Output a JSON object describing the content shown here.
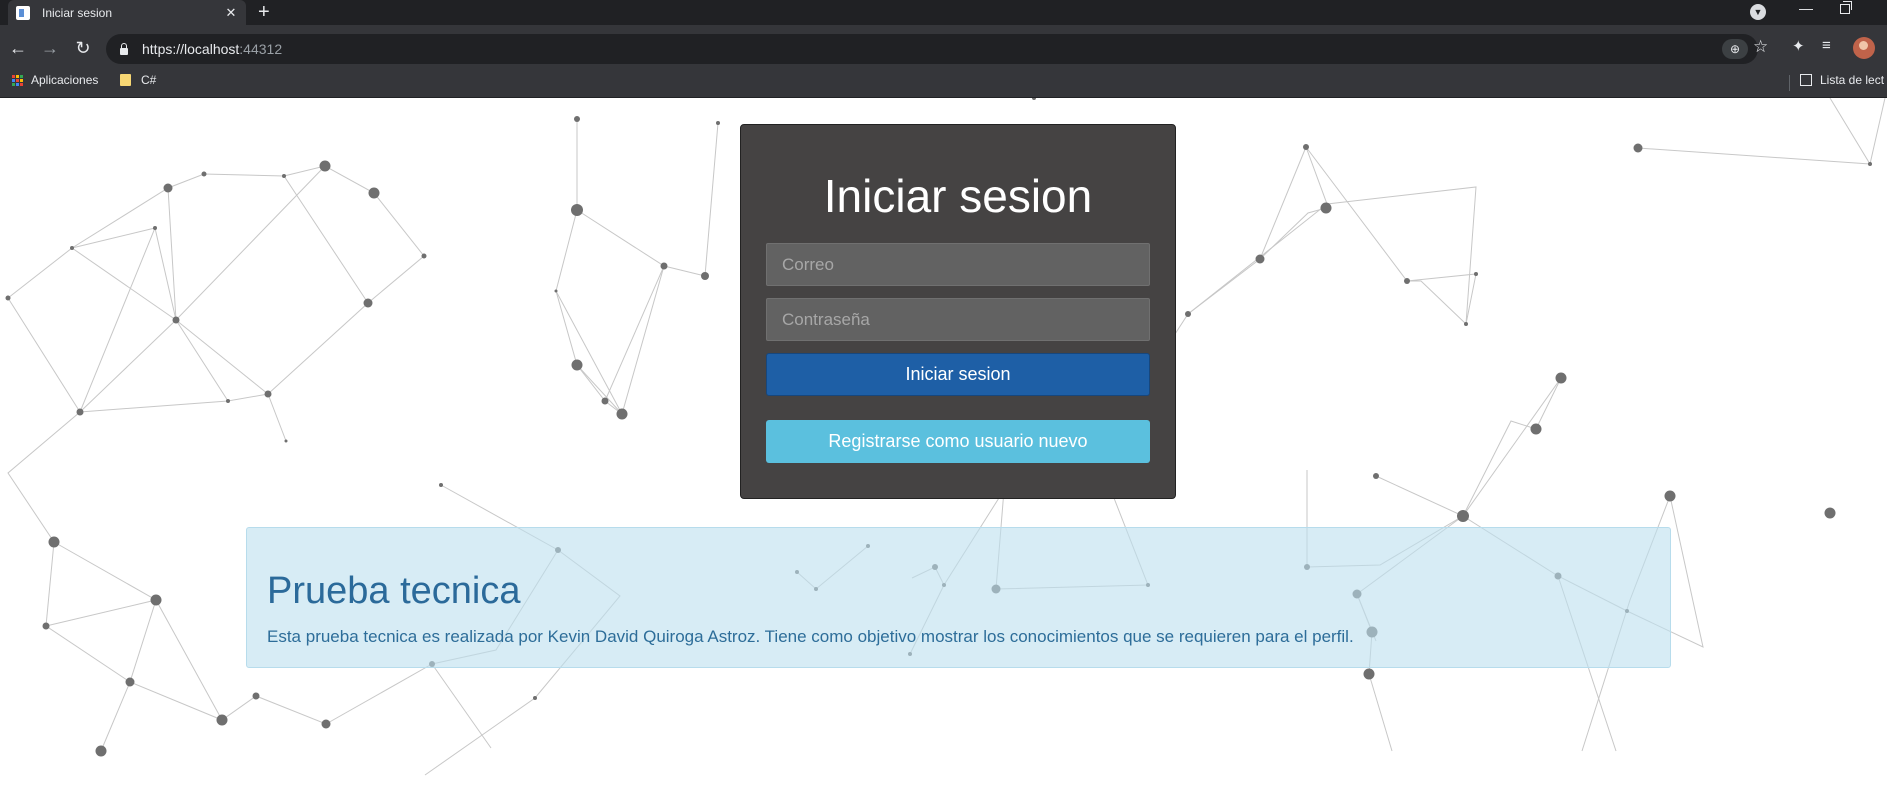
{
  "browser": {
    "tab_title": "Iniciar sesion",
    "tab_close": "✕",
    "new_tab": "+",
    "url_main": "https://localhost",
    "url_port": ":44312",
    "bookmarks": [
      {
        "label": "Aplicaciones",
        "icon": "apps-grid-icon"
      },
      {
        "label": "C#",
        "icon": "folder-icon"
      }
    ],
    "reading_list": "Lista de lect"
  },
  "login": {
    "title": "Iniciar sesion",
    "email_placeholder": "Correo",
    "password_placeholder": "Contraseña",
    "login_button": "Iniciar sesion",
    "register_button": "Registrarse como usuario nuevo"
  },
  "info": {
    "title": "Prueba tecnica",
    "text": "Esta prueba tecnica es realizada por Kevin David Quiroga Astroz. Tiene como objetivo mostrar los conocimientos que se requieren para el perfil."
  },
  "colors": {
    "card_bg": "#454343",
    "primary": "#1e5fa6",
    "info": "#5bc0de",
    "jumbo_bg": "#d7ebf5"
  }
}
